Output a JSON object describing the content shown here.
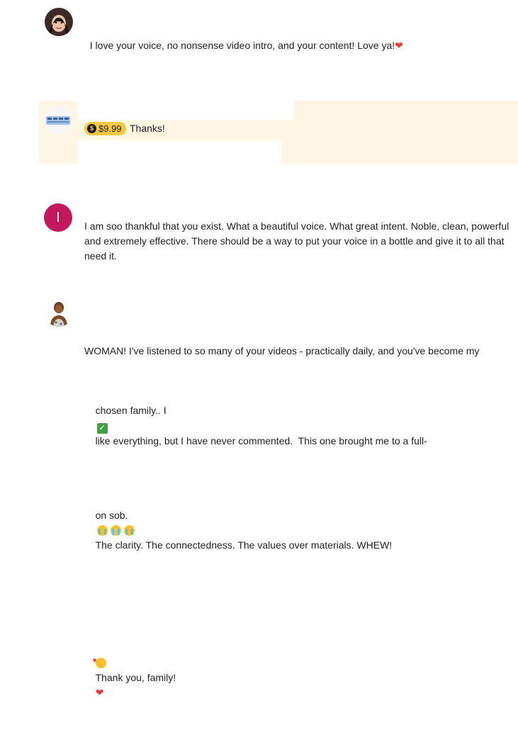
{
  "comments": [
    {
      "text": "I love your voice, no nonsense video intro, and your content! Love ya!",
      "emoji": "❤"
    },
    {
      "super_chat": {
        "amount": "$9.99",
        "currency_symbol": "$",
        "message": "Thanks!"
      }
    },
    {
      "avatar_initial": "I",
      "text": "I am soo thankful that you exist. What a beautiful voice. What great intent. Noble, clean, powerful\nand extremely effective. There should be a way to put your voice in a bottle and give it to all that\nneed it."
    },
    {
      "line1": "WOMAN! I've listened to so many of your videos - practically daily, and you've become my",
      "line2_a": "chosen family.. I",
      "line2_b": "like everything, but I have never commented.  This one brought me to a full-",
      "line3_a": "on sob.",
      "line3_b": "The clarity. The connectedness. The values over materials. WHEW!",
      "line4": "Thank you, family!",
      "check_glyph": "✓",
      "heart": "❤"
    }
  ],
  "colors": {
    "super_chat_highlight": "#fdf7e3",
    "amount_badge": "#f7c843",
    "initial_avatar": "#c2185b",
    "heart": "#e53935"
  }
}
